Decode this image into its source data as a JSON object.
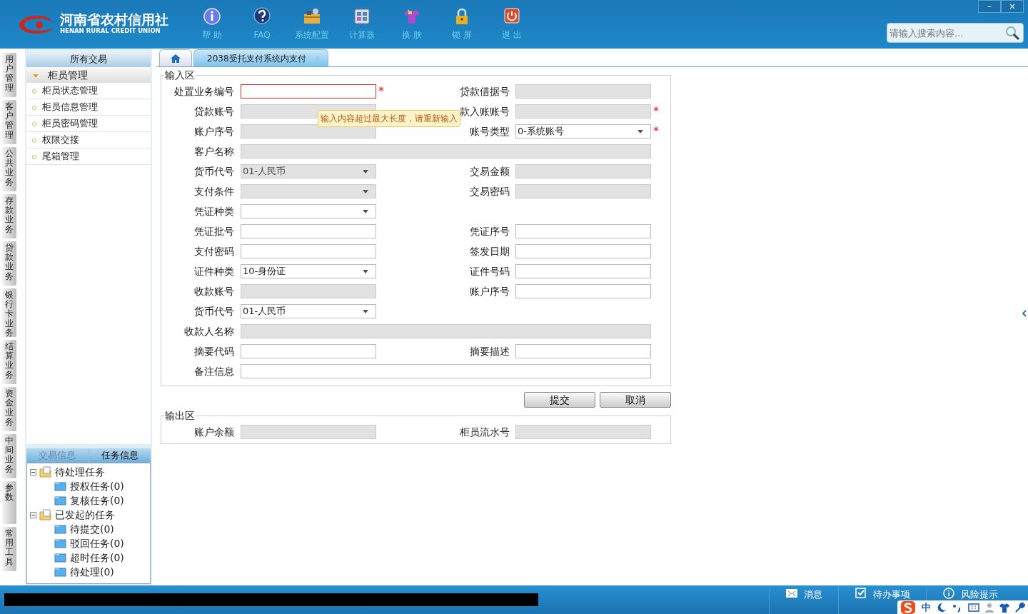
{
  "header": {
    "logo_title": "河南省农村信用社",
    "logo_subtitle": "HENAN RURAL CREDIT UNION",
    "toolbar": [
      {
        "label": "帮 助",
        "kind": "info"
      },
      {
        "label": "FAQ",
        "kind": "question"
      },
      {
        "label": "系统配置",
        "kind": "toolbox"
      },
      {
        "label": "计算器",
        "kind": "calculator"
      },
      {
        "label": "换 肤",
        "kind": "shirt"
      },
      {
        "label": "锁 屏",
        "kind": "lock"
      },
      {
        "label": "退 出",
        "kind": "power"
      }
    ],
    "window_controls": [
      "–",
      "×"
    ],
    "search": {
      "placeholder": "请输入搜索内容..."
    }
  },
  "side_tabs": [
    "用户管理",
    "客户管理",
    "公共业务",
    "存款业务",
    "贷款业务",
    "银行卡业务",
    "结算业务",
    "资金业务",
    "中间业务",
    "参数",
    "常用工具"
  ],
  "nav": {
    "title": "所有交易",
    "group": {
      "label": "柜员管理",
      "expanded": true,
      "items": [
        "柜员状态管理",
        "柜员信息管理",
        "柜员密码管理",
        "权限交接",
        "尾箱管理"
      ]
    },
    "info_tabs": [
      {
        "label": "交易信息",
        "selected": false
      },
      {
        "label": "任务信息",
        "selected": true
      }
    ],
    "tree": [
      {
        "label": "待处理任务",
        "children": [
          {
            "label": "授权任务(0)"
          },
          {
            "label": "复核任务(0)"
          }
        ]
      },
      {
        "label": "已发起的任务",
        "children": [
          {
            "label": "待提交(0)"
          },
          {
            "label": "驳回任务(0)"
          },
          {
            "label": "超时任务(0)"
          },
          {
            "label": "待处理(0)"
          }
        ]
      }
    ]
  },
  "tabs": [
    {
      "kind": "home",
      "selected": false
    },
    {
      "kind": "page",
      "label": "2038受托支付系统内支付",
      "selected": true
    }
  ],
  "input_area": {
    "title": "输入区",
    "rows": [
      [
        {
          "label": "处置业务编号",
          "kind": "text",
          "disabled": false,
          "required_mark": "*",
          "invalid": true
        },
        {
          "label": "贷款借据号",
          "kind": "text",
          "disabled": true,
          "invalid": false
        }
      ],
      [
        {
          "label": "贷款账号",
          "kind": "text",
          "disabled": true,
          "invalid": false
        },
        {
          "label": "款入账账号",
          "kind": "text",
          "disabled": true,
          "required_mark": "*",
          "invalid": false
        }
      ],
      [
        {
          "label": "账户序号",
          "kind": "text",
          "disabled": true,
          "invalid": false
        },
        {
          "label": "账号类型",
          "kind": "select",
          "value": "0-系统账号",
          "disabled": false,
          "required_mark": "*",
          "invalid": false
        }
      ],
      [
        {
          "label": "客户名称",
          "kind": "wide",
          "disabled": true,
          "invalid": false
        }
      ],
      [
        {
          "label": "货币代号",
          "kind": "select",
          "value": "01-人民币",
          "disabled": true,
          "invalid": false
        },
        {
          "label": "交易金额",
          "kind": "text",
          "disabled": true,
          "invalid": false
        }
      ],
      [
        {
          "label": "支付条件",
          "kind": "select",
          "disabled": true,
          "invalid": false
        },
        {
          "label": "交易密码",
          "kind": "text",
          "disabled": true,
          "invalid": false
        }
      ],
      [
        {
          "label": "凭证种类",
          "kind": "select",
          "disabled": false,
          "invalid": false
        }
      ],
      [
        {
          "label": "凭证批号",
          "kind": "text",
          "disabled": false,
          "invalid": false
        },
        {
          "label": "凭证序号",
          "kind": "text",
          "disabled": false,
          "invalid": false
        }
      ],
      [
        {
          "label": "支付密码",
          "kind": "text",
          "disabled": false,
          "invalid": false
        },
        {
          "label": "签发日期",
          "kind": "text",
          "disabled": false,
          "invalid": false
        }
      ],
      [
        {
          "label": "证件种类",
          "kind": "select",
          "value": "10-身份证",
          "disabled": false,
          "invalid": false
        },
        {
          "label": "证件号码",
          "kind": "text",
          "disabled": false,
          "invalid": false
        }
      ],
      [
        {
          "label": "收款账号",
          "kind": "text",
          "disabled": true,
          "invalid": false
        },
        {
          "label": "账户序号",
          "kind": "text",
          "disabled": false,
          "invalid": false
        }
      ],
      [
        {
          "label": "货币代号",
          "kind": "select",
          "value": "01-人民币",
          "disabled": false,
          "invalid": false
        }
      ],
      [
        {
          "label": "收款人名称",
          "kind": "wide",
          "disabled": true,
          "invalid": false
        }
      ],
      [
        {
          "label": "摘要代码",
          "kind": "text",
          "disabled": false,
          "invalid": false
        },
        {
          "label": "摘要描述",
          "kind": "text",
          "disabled": false,
          "invalid": false
        }
      ],
      [
        {
          "label": "备注信息",
          "kind": "wide",
          "disabled": false,
          "invalid": false
        }
      ]
    ]
  },
  "tooltip": "输入内容超过最大长度，请重新输入",
  "buttons": [
    "提交",
    "取消"
  ],
  "output_area": {
    "title": "输出区",
    "rows": [
      [
        {
          "label": "账户余额",
          "kind": "text",
          "disabled": true,
          "invalid": false
        },
        {
          "label": "柜员流水号",
          "kind": "text",
          "disabled": true,
          "invalid": false
        }
      ]
    ]
  },
  "status_bar": {
    "items": [
      {
        "label": "消息",
        "kind": "mail"
      },
      {
        "label": "待办事项",
        "kind": "check"
      },
      {
        "label": "风险提示",
        "kind": "info"
      }
    ],
    "ime": "中"
  }
}
